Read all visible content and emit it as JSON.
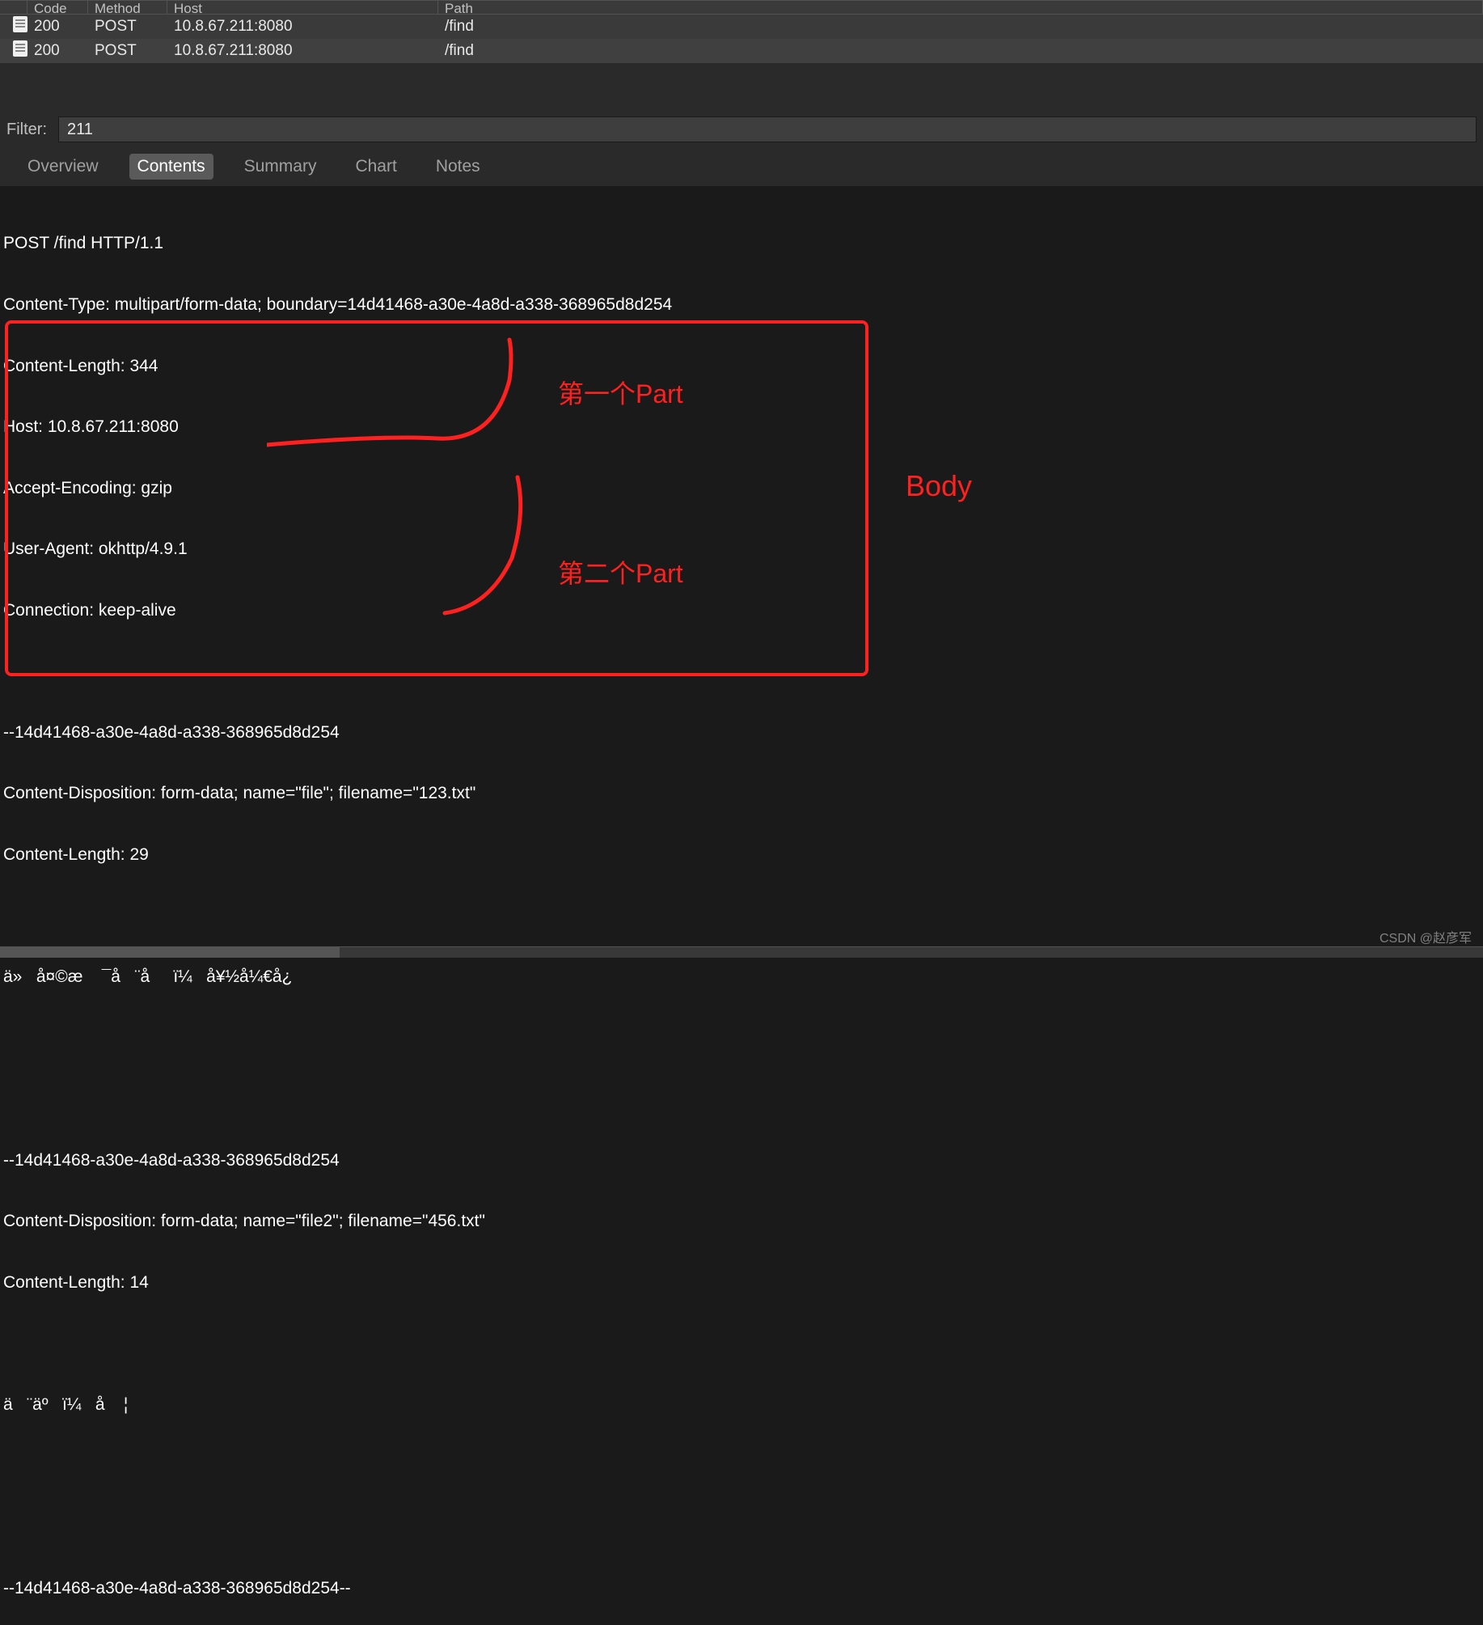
{
  "table": {
    "headers": {
      "code": "Code",
      "method": "Method",
      "host": "Host",
      "path": "Path"
    },
    "rows": [
      {
        "code": "200",
        "method": "POST",
        "host": "10.8.67.211:8080",
        "path": "/find"
      },
      {
        "code": "200",
        "method": "POST",
        "host": "10.8.67.211:8080",
        "path": "/find"
      }
    ]
  },
  "filter": {
    "label": "Filter:",
    "value": "211"
  },
  "tabs": {
    "overview": "Overview",
    "contents": "Contents",
    "summary": "Summary",
    "chart": "Chart",
    "notes": "Notes"
  },
  "content": {
    "request_line": "POST /find HTTP/1.1",
    "content_type": "Content-Type: multipart/form-data; boundary=14d41468-a30e-4a8d-a338-368965d8d254",
    "content_length": "Content-Length: 344",
    "host": "Host: 10.8.67.211:8080",
    "accept_encoding": "Accept-Encoding: gzip",
    "user_agent": "User-Agent: okhttp/4.9.1",
    "connection": "Connection: keep-alive",
    "boundary1": "--14d41468-a30e-4a8d-a338-368965d8d254",
    "disposition1": "Content-Disposition: form-data; name=\"file\"; filename=\"123.txt\"",
    "length1": "Content-Length: 29",
    "data1": "ä»   å¤©æ    ¯å   ¨å     ï¼   å¥½å¼€å¿",
    "boundary2": "--14d41468-a30e-4a8d-a338-368965d8d254",
    "disposition2": "Content-Disposition: form-data; name=\"file2\"; filename=\"456.txt\"",
    "length2": "Content-Length: 14",
    "data2": "ä   ¨äº   ï¼   å    ¦",
    "boundary_end": "--14d41468-a30e-4a8d-a338-368965d8d254--"
  },
  "annotations": {
    "part1": "第一个Part",
    "part2": "第二个Part",
    "body": "Body"
  },
  "watermark": "CSDN @赵彦军"
}
